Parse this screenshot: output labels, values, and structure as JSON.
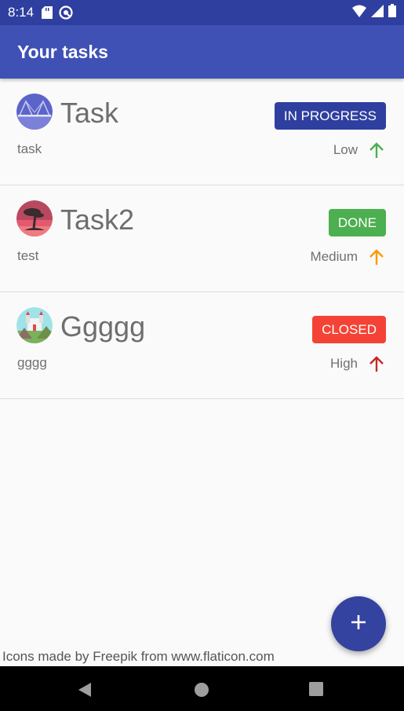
{
  "status_bar": {
    "time": "8:14",
    "icons": [
      "sd-card-icon",
      "no-disturb-icon",
      "wifi-icon",
      "signal-icon",
      "battery-icon"
    ]
  },
  "app_bar": {
    "title": "Your tasks"
  },
  "tasks": [
    {
      "title": "Task",
      "description": "task",
      "status": "IN PROGRESS",
      "status_color": "#2f3f9f",
      "priority": "Low",
      "priority_color": "#4caf50",
      "avatar": "bridge-icon"
    },
    {
      "title": "Task2",
      "description": "test",
      "status": "DONE",
      "status_color": "#4caf50",
      "priority": "Medium",
      "priority_color": "#ff9800",
      "avatar": "tree-sunset-icon"
    },
    {
      "title": "Ggggg",
      "description": "gggg",
      "status": "CLOSED",
      "status_color": "#f44336",
      "priority": "High",
      "priority_color": "#c62828",
      "avatar": "castle-icon"
    }
  ],
  "credit": "Icons made by Freepik from www.flaticon.com",
  "fab": {
    "icon": "plus-icon"
  },
  "nav_bar": {
    "icons": [
      "back-icon",
      "home-icon",
      "recents-icon"
    ]
  }
}
